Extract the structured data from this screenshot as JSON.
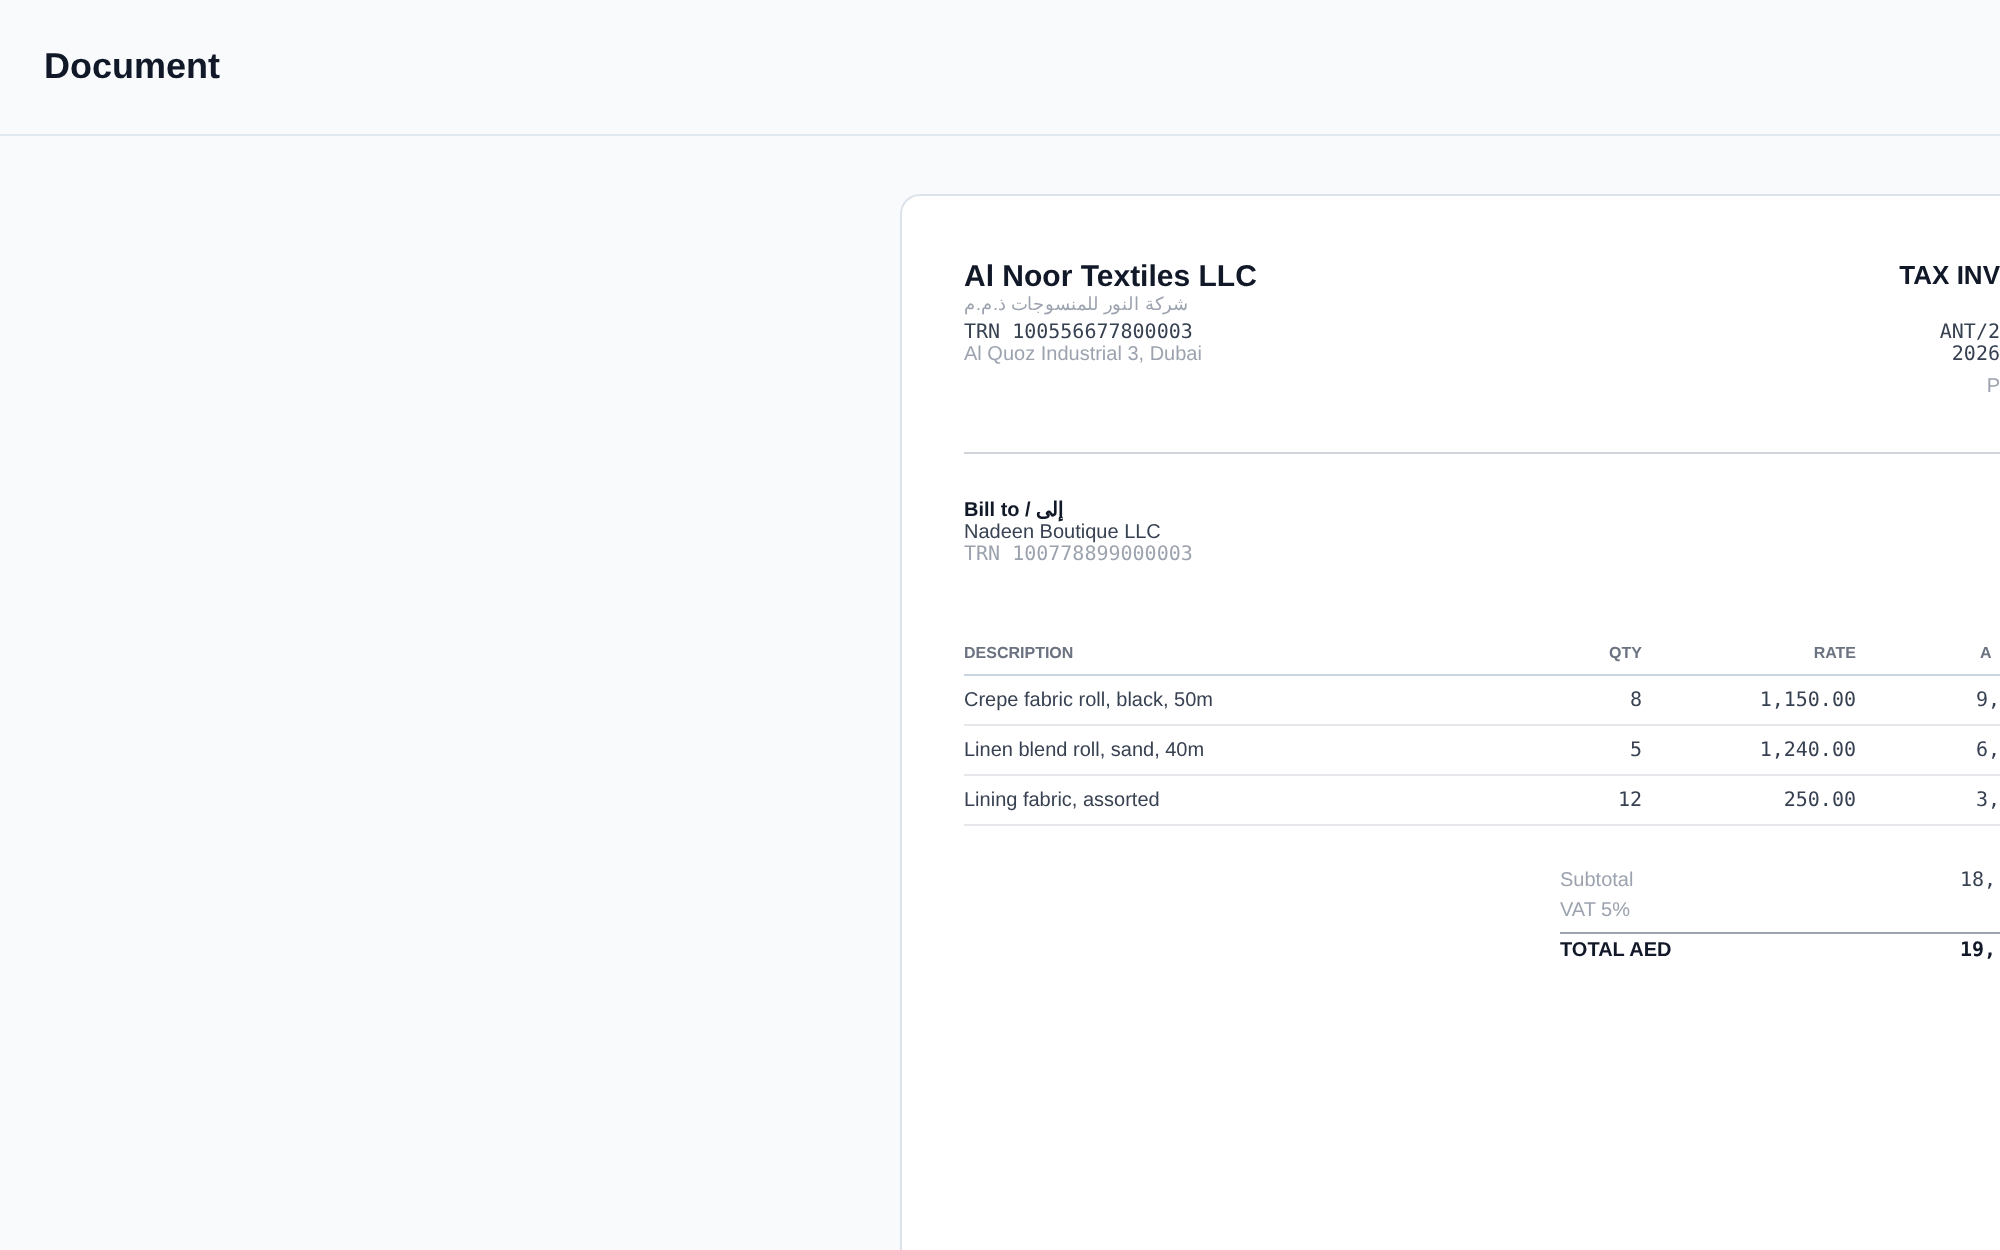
{
  "header": {
    "title": "Document"
  },
  "invoice": {
    "seller": {
      "name": "Al Noor Textiles LLC",
      "name_arabic": "شركة النور للمنسوجات ذ.م.م",
      "trn": "TRN 100556677800003",
      "address": "Al Quoz Industrial 3, Dubai"
    },
    "meta": {
      "title": "TAX INV",
      "number": "ANT/2",
      "date": "2026",
      "status": "P"
    },
    "bill_to": {
      "label": "Bill to / إلى",
      "name": "Nadeen Boutique LLC",
      "trn": "TRN 100778899000003"
    },
    "table": {
      "columns": [
        "DESCRIPTION",
        "QTY",
        "RATE",
        "A"
      ],
      "rows": [
        [
          "Crepe fabric roll, black, 50m",
          "8",
          "1,150.00",
          "9,"
        ],
        [
          "Linen blend roll, sand, 40m",
          "5",
          "1,240.00",
          "6,"
        ],
        [
          "Lining fabric, assorted",
          "12",
          "250.00",
          "3,"
        ]
      ]
    },
    "totals": [
      {
        "label": "Subtotal",
        "value": "18,",
        "kind": "normal"
      },
      {
        "label": "VAT 5%",
        "kind": "normal"
      },
      {
        "label": "TOTAL AED",
        "value": "19,",
        "kind": "total"
      }
    ]
  }
}
